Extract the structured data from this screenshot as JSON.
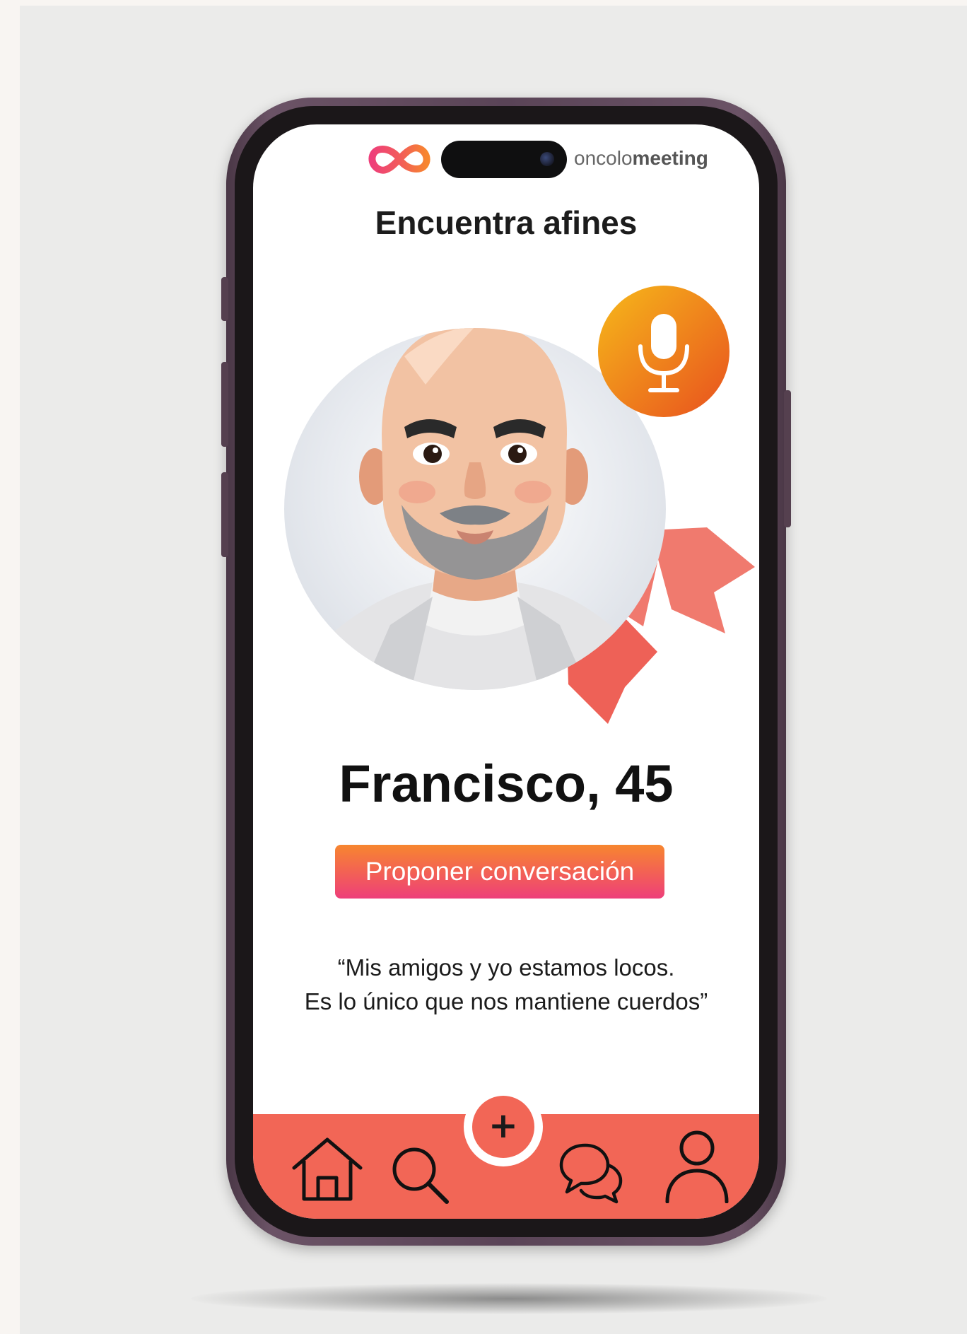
{
  "app": {
    "brand_regular": "oncolo",
    "brand_bold": "meeting",
    "screen_title": "Encuentra afines"
  },
  "profile": {
    "name_age": "Francisco, 45",
    "cta_label": "Proponer conversación",
    "quote_line1": "“Mis amigos y yo estamos locos.",
    "quote_line2": "Es lo único que nos mantiene cuerdos”"
  },
  "icons": {
    "logo": "infinity-logo-icon",
    "voice": "microphone-icon",
    "badge": "ribbon-icon",
    "home": "home-icon",
    "search": "search-icon",
    "add": "plus-icon",
    "chat": "chat-bubbles-icon",
    "profile": "user-icon"
  },
  "nav": {
    "add_symbol": "+"
  },
  "colors": {
    "accent_coral": "#f26656",
    "accent_orange": "#f08a1c",
    "accent_pink": "#ee3f7a",
    "ribbon_red": "#ef6a60"
  }
}
